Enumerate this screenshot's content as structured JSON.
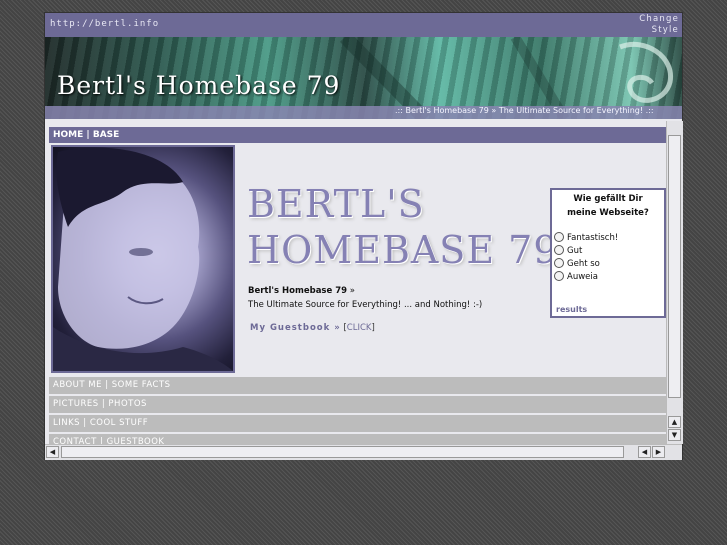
{
  "topbar": {
    "url": "http://bertl.info",
    "change_line1": "Change",
    "change_line2": "Style"
  },
  "banner": {
    "title": "Bertl's Homebase 79",
    "marquee": ".:: Bertl's Homebase 79 » The Ultimate Source for Everything! .:: "
  },
  "nav": {
    "home": "HOME | BASE",
    "about": "ABOUT ME | SOME FACTS",
    "pictures": "PICTURES | PHOTOS",
    "links": "LINKS | COOL STUFF",
    "contact": "CONTACT | GUESTBOOK"
  },
  "main": {
    "logo_line1": "BERTL'S",
    "logo_line2": "HOMEBASE 79",
    "intro_name": "Bertl's Homebase 79",
    "intro_arrow": "»",
    "intro_tagline": "The Ultimate Source for Everything! ... and Nothing! :-)",
    "guestbook_link": "My Guestbook »",
    "click_open": "[",
    "click_label": "CLICK",
    "click_close": "]"
  },
  "poll": {
    "question_line1": "Wie gefällt Dir",
    "question_line2": "meine Webseite?",
    "options": [
      "Fantastisch!",
      "Gut",
      "Geht so",
      "Auweia"
    ],
    "results": "results"
  },
  "scroll": {
    "up": "▲",
    "down": "▼",
    "left": "◀",
    "right": "▶"
  },
  "colors": {
    "accent": "#6d6a96",
    "nav_gray": "#bcbcbc",
    "background": "#e9e9ee"
  }
}
